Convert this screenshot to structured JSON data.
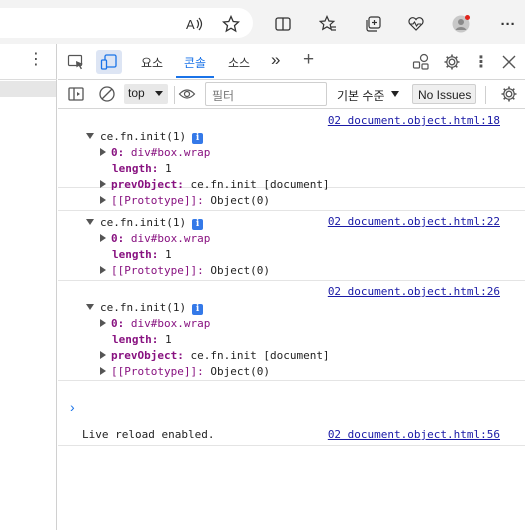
{
  "browser": {
    "icons": [
      "read-aloud-icon",
      "favorite-star-icon",
      "split-screen-icon",
      "favorites-icon",
      "collections-icon",
      "browser-essentials-icon",
      "profile-avatar-icon",
      "more-icon"
    ],
    "more_label": "···"
  },
  "page": {
    "kebab_label": "⋮"
  },
  "devtools": {
    "tabs": [
      {
        "label": "요소",
        "active": false
      },
      {
        "label": "콘솔",
        "active": true
      },
      {
        "label": "소스",
        "active": false
      }
    ],
    "more_tabs_label": "»",
    "add_tab_label": "+",
    "context_select": "top",
    "filter_placeholder": "필터",
    "levels_label": "기본 수준",
    "issues_label": "No Issues",
    "accent_color": "#1a73e8"
  },
  "console": {
    "messages": [
      {
        "source": "02 document.object.html:18",
        "header": "ce.fn.init(1)",
        "rows": [
          {
            "expand": true,
            "key": "0:",
            "value": "div#box.wrap",
            "value_color": "#881280"
          },
          {
            "expand": false,
            "key": "length:",
            "value": "1"
          },
          {
            "expand": true,
            "key": "prevObject:",
            "value": "ce.fn.init [document]"
          },
          {
            "expand": true,
            "key": "[[Prototype]]:",
            "value": "Object(0)"
          }
        ]
      },
      {
        "source": "02 document.object.html:22",
        "header": "ce.fn.init(1)",
        "rows": [
          {
            "expand": true,
            "key": "0:",
            "value": "div#box.wrap"
          },
          {
            "expand": false,
            "key": "length:",
            "value": "1"
          },
          {
            "expand": true,
            "key": "[[Prototype]]:",
            "value": "Object(0)"
          }
        ]
      },
      {
        "source": "02 document.object.html:26",
        "header": "ce.fn.init(1)",
        "rows": [
          {
            "expand": true,
            "key": "0:",
            "value": "div#box.wrap"
          },
          {
            "expand": false,
            "key": "length:",
            "value": "1"
          },
          {
            "expand": true,
            "key": "prevObject:",
            "value": "ce.fn.init [document]"
          },
          {
            "expand": true,
            "key": "[[Prototype]]:",
            "value": "Object(0)"
          }
        ]
      }
    ],
    "log": {
      "text": "Live reload enabled.",
      "source": "02 document.object.html:56"
    },
    "prompt": "›"
  }
}
